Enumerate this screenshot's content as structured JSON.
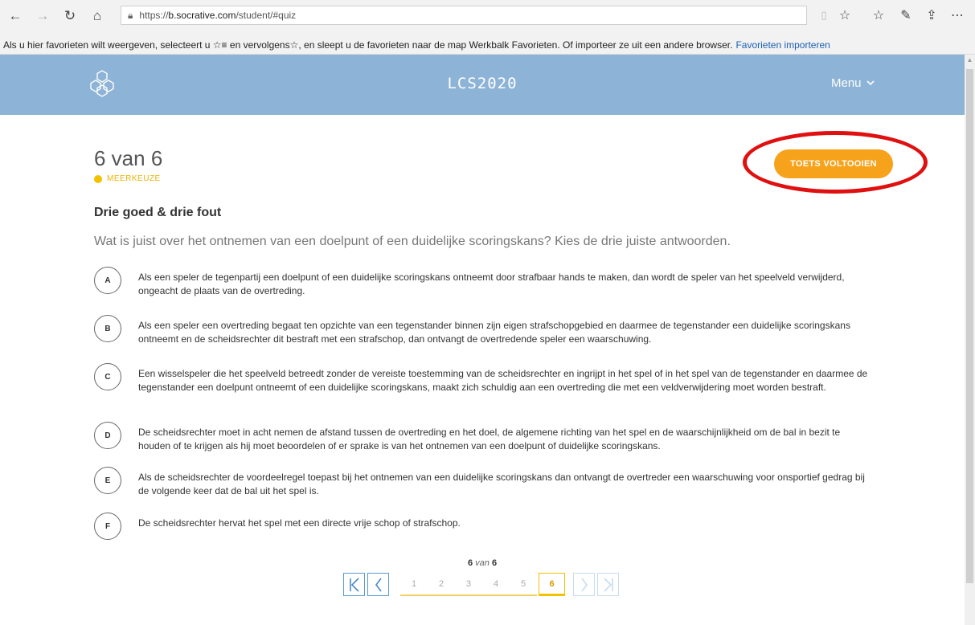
{
  "browser": {
    "url_prefix": "https://",
    "url_host": "b.socrative.com",
    "url_path": "/student/#quiz",
    "favbar_text": "Als u hier favorieten wilt weergeven, selecteert u ☆≡ en vervolgens☆, en sleept u de favorieten naar de map Werkbalk Favorieten. Of importeer ze uit een andere browser.",
    "favbar_link": "Favorieten importeren"
  },
  "header": {
    "brand": "LCS2020",
    "menu_label": "Menu"
  },
  "quiz": {
    "counter": "6 van 6",
    "question_type": "MEERKEUZE",
    "finish_label": "TOETS VOLTOOIEN",
    "title": "Drie goed & drie fout",
    "prompt": "Wat is juist over het ontnemen van een doelpunt of een duidelijke scoringskans? Kies de drie juiste antwoorden.",
    "answers": [
      {
        "letter": "A",
        "text": "Als een speler de tegenpartij een doelpunt of een duidelijke scoringskans ontneemt door strafbaar hands te maken, dan wordt de speler van het speelveld verwijderd, ongeacht de plaats van de overtreding."
      },
      {
        "letter": "B",
        "text": "Als een speler een overtreding begaat ten opzichte van een tegenstander binnen zijn eigen strafschopgebied en daarmee de tegenstander een duidelijke scoringskans ontneemt en de scheidsrechter dit bestraft met een strafschop, dan ontvangt de overtredende speler een waarschuwing."
      },
      {
        "letter": "C",
        "text": "Een wisselspeler die het speelveld betreedt zonder de vereiste toestemming van de scheidsrechter en ingrijpt in het spel of in het spel van de tegenstander en daarmee de tegenstander een doelpunt ontneemt of een duidelijke scoringskans, maakt zich schuldig aan een overtreding die met een veldverwijdering moet worden bestraft."
      },
      {
        "letter": "D",
        "text": "De scheidsrechter moet in acht nemen de afstand tussen de overtreding en het doel, de algemene richting van het spel en de waarschijnlijkheid om de bal in bezit te houden of te krijgen als hij moet beoordelen of er sprake is van het ontnemen van een doelpunt of duidelijke scoringskans."
      },
      {
        "letter": "E",
        "text": " Als de scheidsrechter de voordeelregel toepast bij het ontnemen van een duidelijke scoringskans dan ontvangt de overtreder een waarschuwing voor onsportief gedrag bij de volgende keer dat de bal uit het spel is."
      },
      {
        "letter": "F",
        "text": "De scheidsrechter hervat het spel met een directe vrije schop of strafschop."
      }
    ]
  },
  "pagination": {
    "current": "6",
    "of_word": "van",
    "total": "6",
    "pages": [
      "1",
      "2",
      "3",
      "4",
      "5",
      "6"
    ]
  },
  "colors": {
    "header_bg": "#8db3d6",
    "finish_button": "#f7a21b",
    "annotation": "#e01010",
    "type_dot": "#f2c100"
  }
}
